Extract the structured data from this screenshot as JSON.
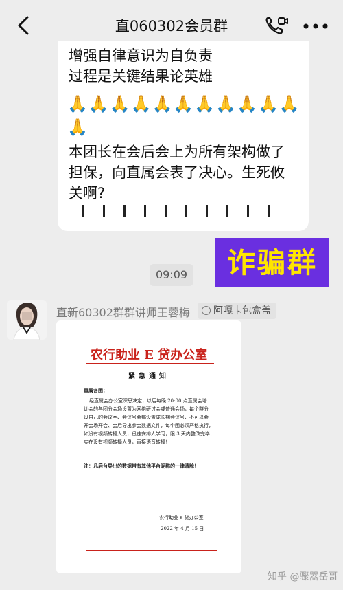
{
  "header": {
    "title": "直060302会员群"
  },
  "icons": {
    "back": "chevron-left-icon",
    "call": "video-call-icon",
    "more": "more-dots-icon"
  },
  "message1": {
    "lines": [
      "增强自律意识为自负责",
      "过程是关键结果论英雄"
    ],
    "emoji_row_1": "🙏🙏🙏🙏🙏🙏🙏🙏🙏🙏🙏",
    "emoji_row_2": "🙏",
    "lines2": [
      "本团长在会后会上为所有架构做了",
      "担保，向直属会表了决心。生死攸",
      "关啊?"
    ]
  },
  "fraud_label": "诈骗群",
  "time": "09:09",
  "sender": {
    "name": "直新60302群群讲师王蓉梅",
    "badge": "阿嘎卡包盒盖"
  },
  "document": {
    "title": "农行助业 E 贷办公室",
    "subtitle": "紧急通知",
    "greeting": "直属各团：",
    "body": [
      "经直属会办公室深思决定，以后每晚 20:00 点直属会培",
      "训会的各团分会场设置为网络研讨会或普通会场，每个群分",
      "设自己的会议室、会议号会都设置成长期会议号、不可以会",
      "开会场开会、会后导出参会数据文件，每个团必须严格执行，",
      "如没有视频转播人员，迅速安排人学习，限 3 天内整改完毕！",
      "实在没有视频转播人员，直接语音转播！"
    ],
    "note": "注：凡后台导出的数据带有其他平台昵称的一律清除！",
    "signature": "农行助业 e 贷办公室",
    "date": "2022 年 4 月 15 日"
  },
  "watermark": "知乎 @骤器岳哥",
  "colors": {
    "fraud_bg": "#6a2fe0",
    "fraud_text": "#ffe500",
    "doc_red": "#c9221b"
  }
}
